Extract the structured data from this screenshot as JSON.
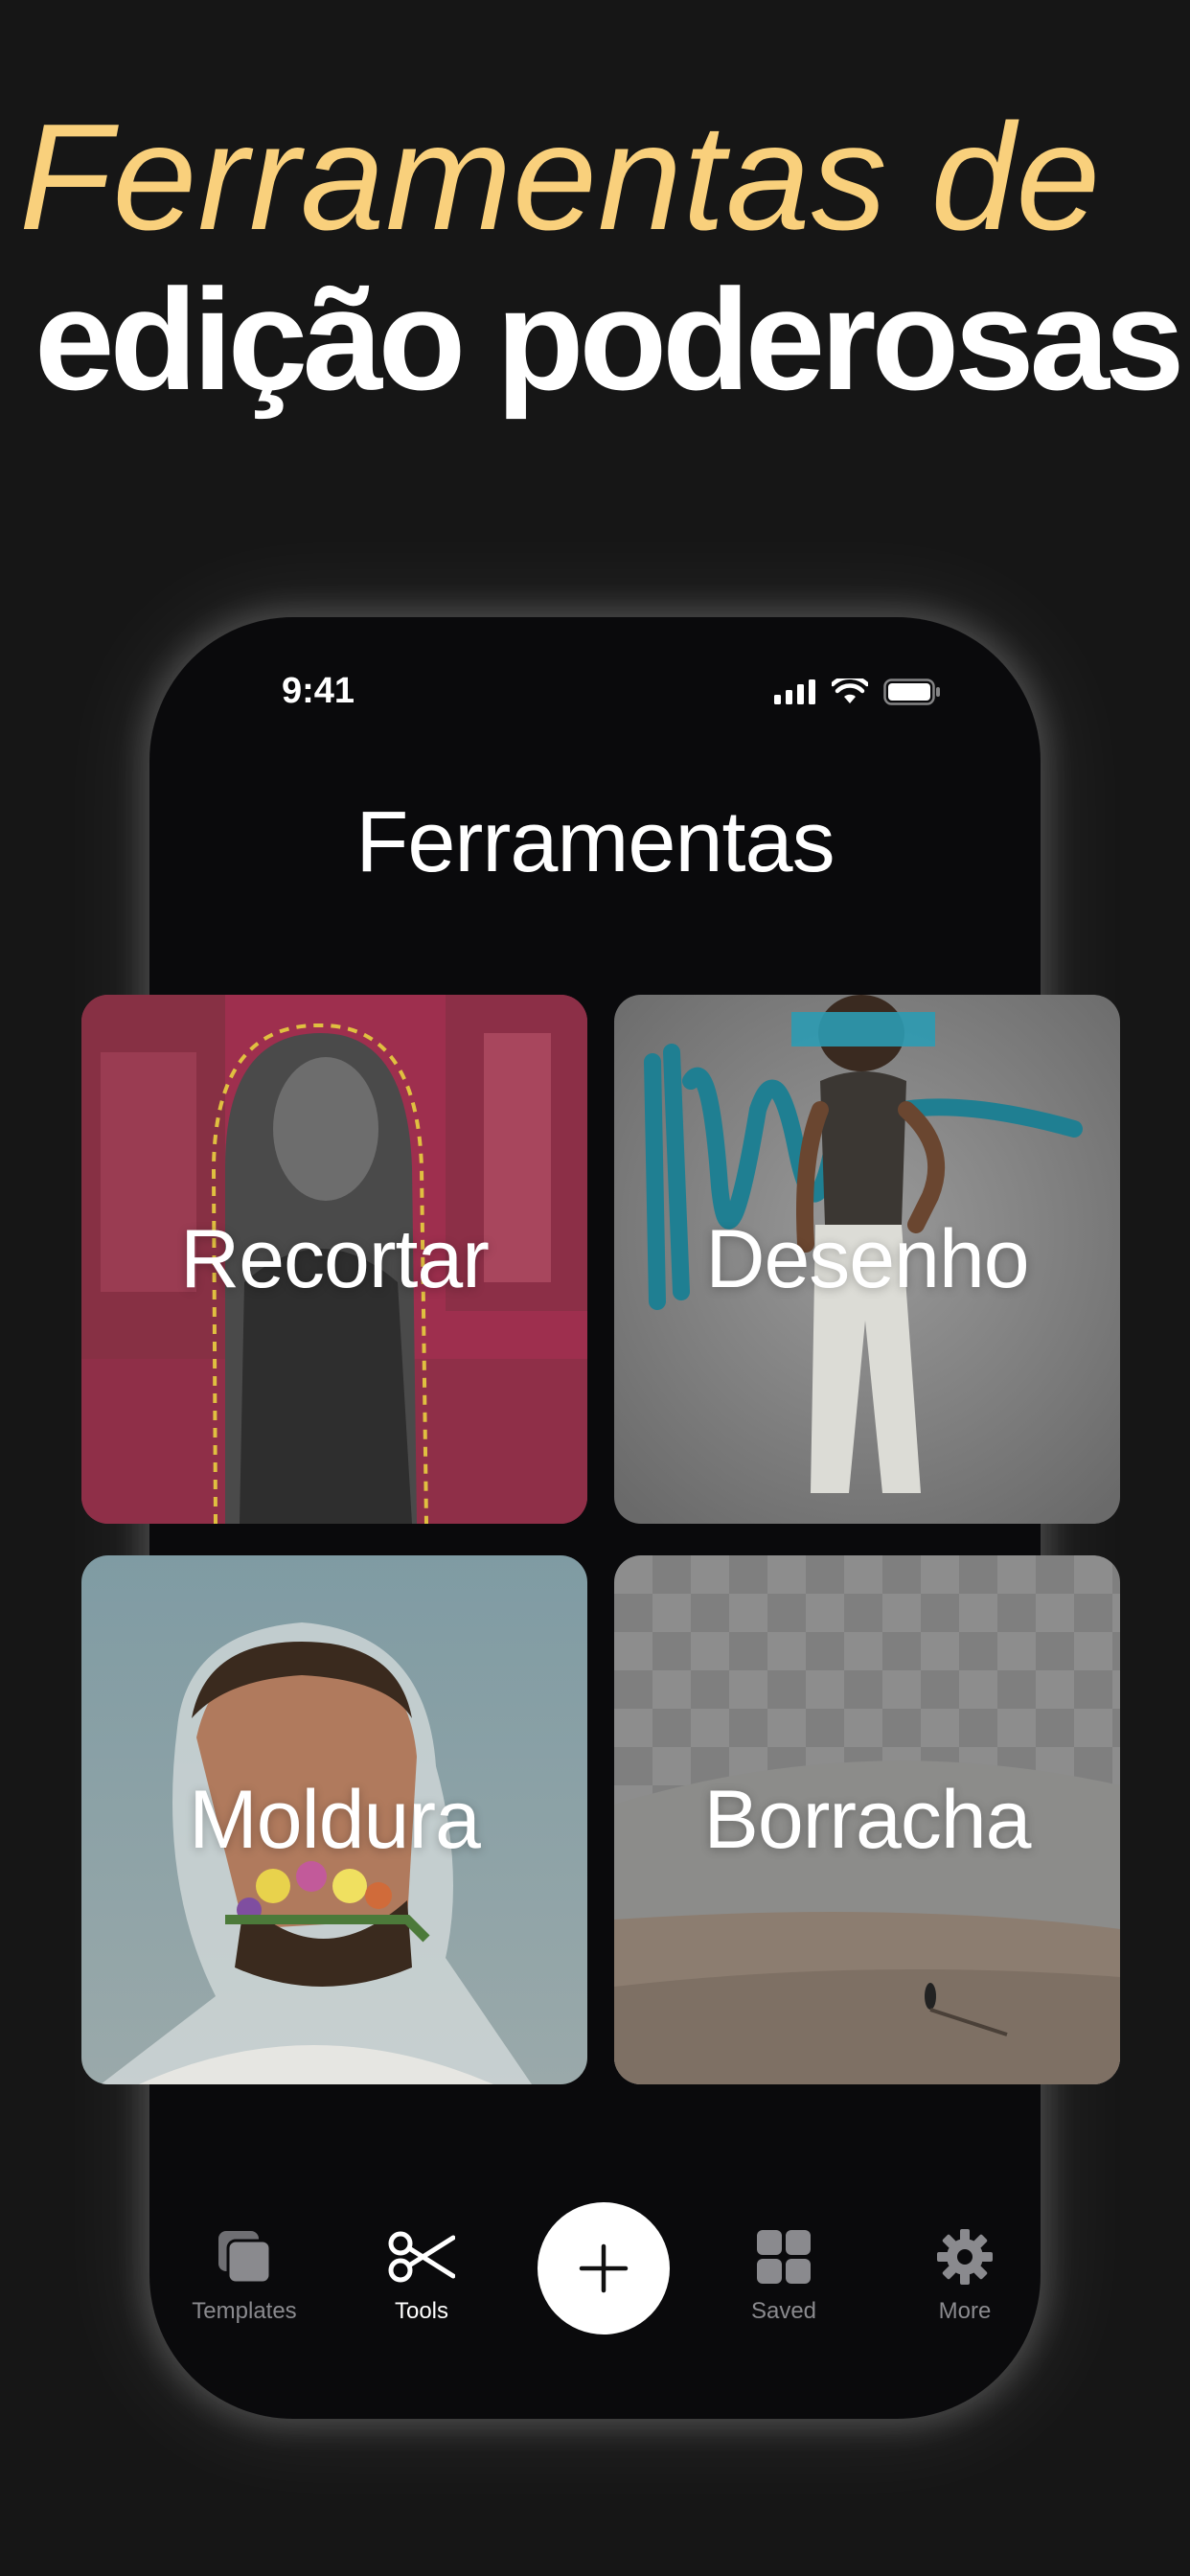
{
  "headline": {
    "line1": "Ferramentas de",
    "line2": "edição poderosas"
  },
  "status_bar": {
    "time": "9:41"
  },
  "screen": {
    "title": "Ferramentas"
  },
  "tools": [
    {
      "label": "Recortar",
      "icon": "cutout-photo"
    },
    {
      "label": "Desenho",
      "icon": "drawing-photo"
    },
    {
      "label": "Moldura",
      "icon": "frame-photo"
    },
    {
      "label": "Borracha",
      "icon": "eraser-photo"
    }
  ],
  "tab_bar": {
    "items": [
      {
        "label": "Templates",
        "icon": "templates-icon",
        "active": false
      },
      {
        "label": "Tools",
        "icon": "scissors-icon",
        "active": true
      },
      {
        "label": "Saved",
        "icon": "grid-icon",
        "active": false
      },
      {
        "label": "More",
        "icon": "gear-icon",
        "active": false
      }
    ],
    "add_icon": "plus-icon"
  },
  "colors": {
    "background": "#161616",
    "accent": "#F9D07C",
    "phone": "#0A0A0C",
    "cutout_tint": "#9E2F4E",
    "tab_inactive": "#8A8A8E"
  }
}
